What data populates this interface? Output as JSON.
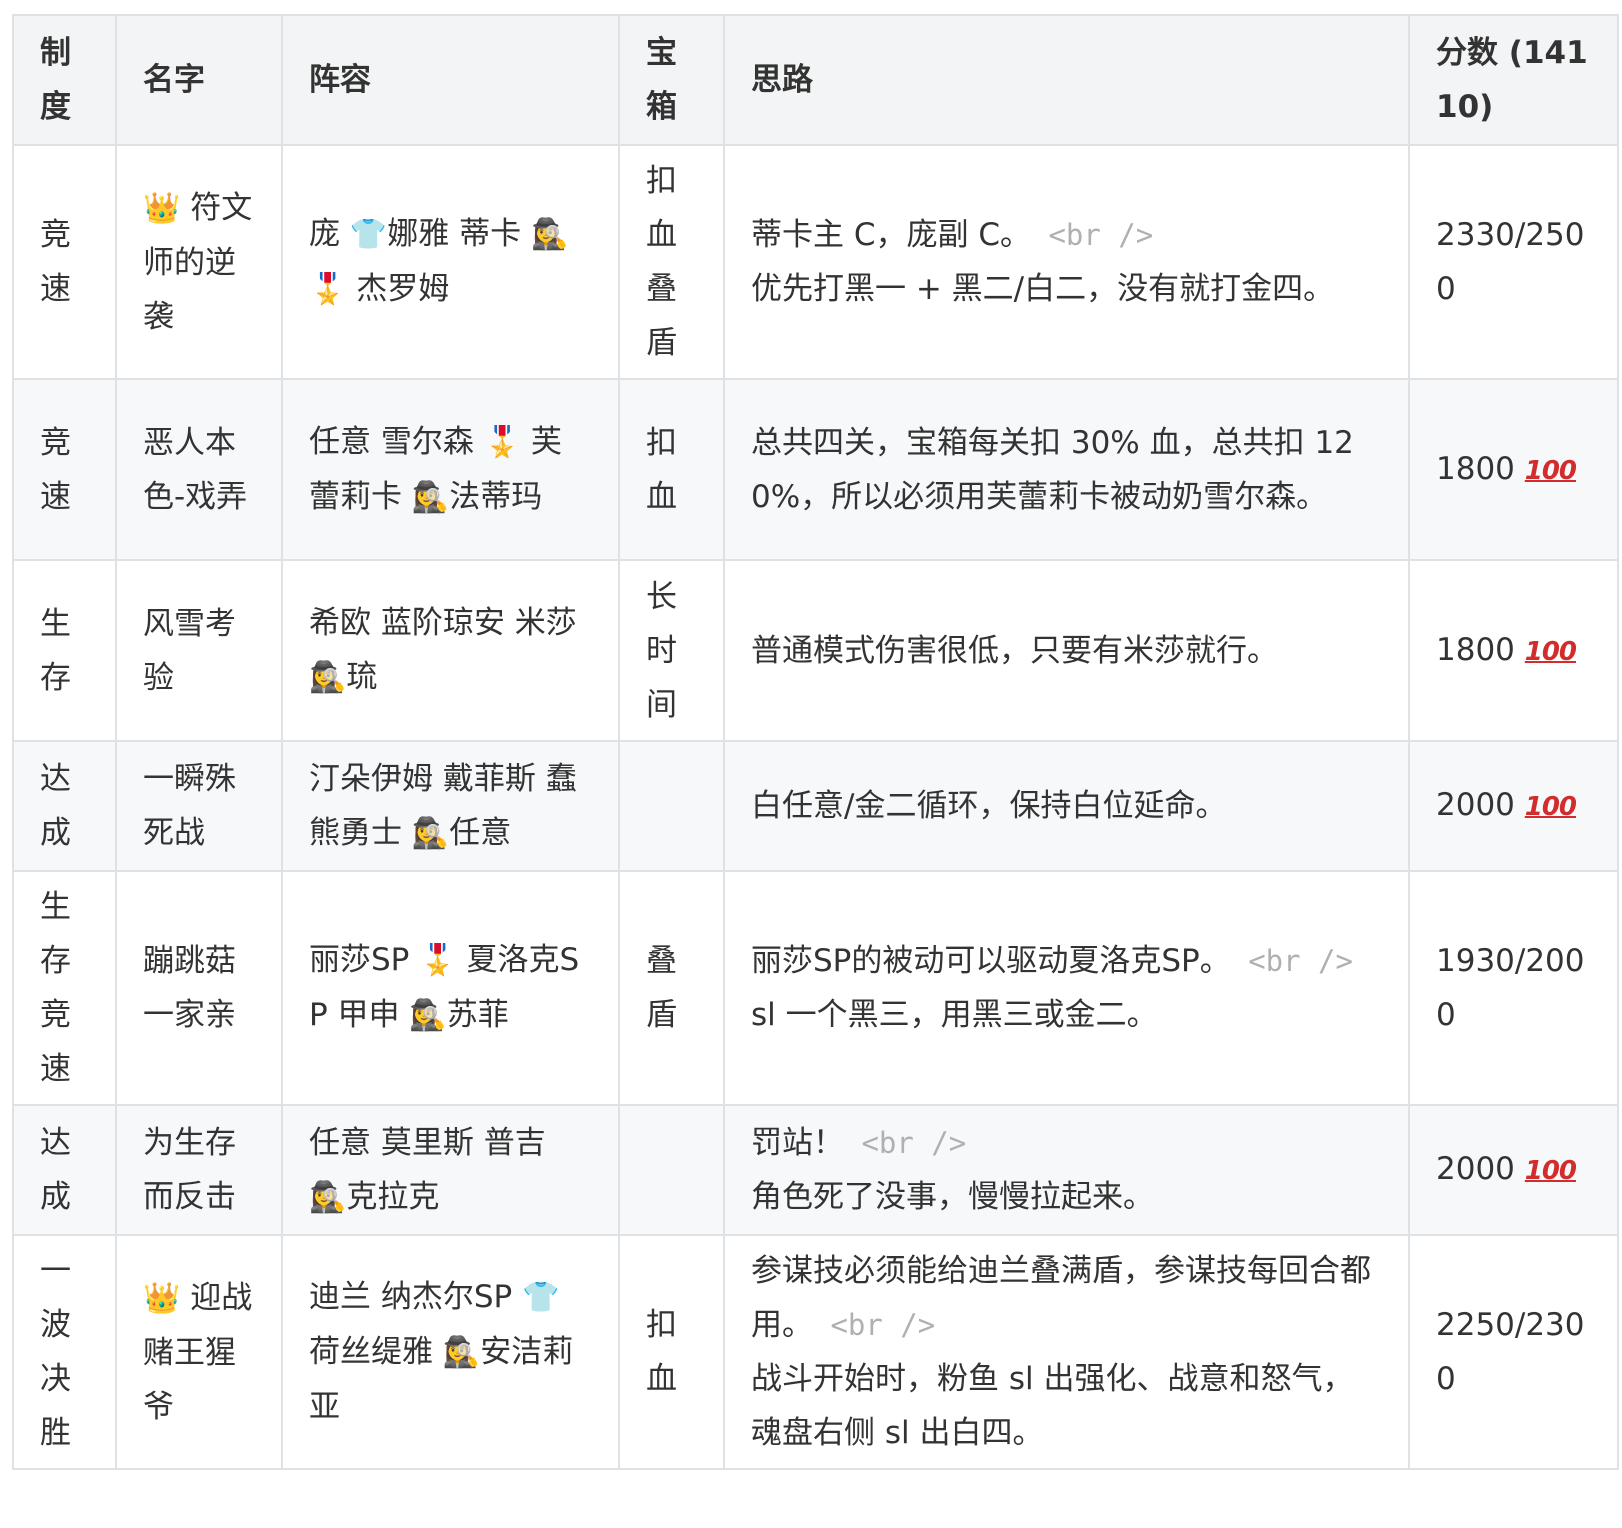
{
  "headers": {
    "system": "制度",
    "name": "名字",
    "lineup": "阵容",
    "chest": "宝箱",
    "idea": "思路",
    "score": "分数 (14110)"
  },
  "rows": [
    {
      "system": "竞速",
      "name_icon": "👑",
      "name": " 符文师的逆袭",
      "lineup_parts": [
        "庞 ",
        "👕",
        "娜雅 蒂卡 ",
        "🕵️‍♀️",
        " ",
        "🎖️",
        " 杰罗姆"
      ],
      "chest": "扣血叠盾",
      "idea_lines": [
        "蒂卡主 C，庞副 C。",
        "优先打黑一 + 黑二/白二，没有就打金四。"
      ],
      "idea_br_after_line": 0,
      "score": "2330/2500",
      "score_badge": ""
    },
    {
      "system": "竞速",
      "name_icon": "",
      "name": "恶人本色-戏弄",
      "lineup_parts": [
        "任意 雪尔森 ",
        "🎖️",
        " 芙蕾莉卡 ",
        "🕵️‍♀️",
        "法蒂玛"
      ],
      "chest": "扣血",
      "idea_lines": [
        "总共四关，宝箱每关扣 30% 血，总共扣 120%，所以必须用芙蕾莉卡被动奶雪尔森。"
      ],
      "idea_br_after_line": -1,
      "score": "1800 ",
      "score_badge": "100"
    },
    {
      "system": "生存",
      "name_icon": "",
      "name": "风雪考验",
      "lineup_parts": [
        "希欧 蓝阶琼安 米莎 ",
        "🕵️‍♀️",
        "琉"
      ],
      "chest": "长时间",
      "idea_lines": [
        "普通模式伤害很低，只要有米莎就行。"
      ],
      "idea_br_after_line": -1,
      "score": "1800 ",
      "score_badge": "100"
    },
    {
      "system": "达成",
      "name_icon": "",
      "name": "一瞬殊死战",
      "lineup_parts": [
        "汀朵伊姆 戴菲斯 蠢熊勇士 ",
        "🕵️‍♀️",
        "任意"
      ],
      "chest": "",
      "idea_lines": [
        "白任意/金二循环，保持白位延命。"
      ],
      "idea_br_after_line": -1,
      "score": "2000 ",
      "score_badge": "100"
    },
    {
      "system": "生存竞速",
      "name_icon": "",
      "name": "蹦跳菇一家亲",
      "lineup_parts": [
        "丽莎SP ",
        "🎖️",
        " 夏洛克SP 甲申 ",
        "🕵️‍♀️",
        "苏菲"
      ],
      "chest": "叠盾",
      "idea_lines": [
        "丽莎SP的被动可以驱动夏洛克SP。",
        "sl 一个黑三，用黑三或金二。"
      ],
      "idea_br_after_line": 0,
      "score": "1930/2000",
      "score_badge": ""
    },
    {
      "system": "达成",
      "name_icon": "",
      "name": "为生存而反击",
      "lineup_parts": [
        "任意 莫里斯 普吉 ",
        "🕵️‍♀️",
        "克拉克"
      ],
      "chest": "",
      "idea_lines": [
        "罚站！",
        "角色死了没事，慢慢拉起来。"
      ],
      "idea_br_after_line": 0,
      "score": "2000 ",
      "score_badge": "100"
    },
    {
      "system": "一波决胜",
      "name_icon": "👑",
      "name": " 迎战赌王猩爷",
      "lineup_parts": [
        "迪兰 纳杰尔SP ",
        "👕",
        " 荷丝缇雅 ",
        "🕵️‍♀️",
        "安洁莉亚"
      ],
      "chest": "扣血",
      "idea_lines": [
        "参谋技必须能给迪兰叠满盾，参谋技每回合都用。",
        "战斗开始时，粉鱼 sl 出强化、战意和怒气，魂盘右侧 sl 出白四。"
      ],
      "idea_br_after_line": 0,
      "score": "2250/2300",
      "score_badge": ""
    }
  ],
  "br_literal": "<br />",
  "colors": {
    "border": "#dfe2e5",
    "header_bg": "#f3f4f5",
    "stripe_bg": "#f6f8fa",
    "text": "#333333",
    "badge": "#d22d2d"
  }
}
